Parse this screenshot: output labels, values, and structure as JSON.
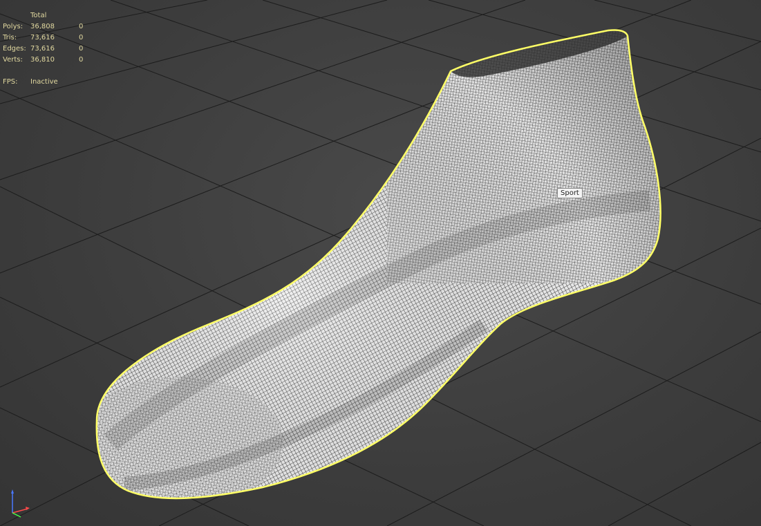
{
  "stats": {
    "header": "Total",
    "rows": [
      {
        "label": "Polys:",
        "total": "36,808",
        "selected": "0"
      },
      {
        "label": "Tris:",
        "total": "73,616",
        "selected": "0"
      },
      {
        "label": "Edges:",
        "total": "73,616",
        "selected": "0"
      },
      {
        "label": "Verts:",
        "total": "36,810",
        "selected": "0"
      }
    ],
    "fps_label": "FPS:",
    "fps_value": "Inactive"
  },
  "tooltip": {
    "text": "Sport"
  },
  "colors": {
    "background": "#3f3f3f",
    "grid": "#1e1e1e",
    "stats_text": "#e2d9a0",
    "selection_outline": "#ffff66",
    "mesh_fill": "#e9e9e9",
    "wire": "#111111"
  },
  "icons": {
    "axis_gizmo": "xyz-axis-gizmo-icon"
  }
}
